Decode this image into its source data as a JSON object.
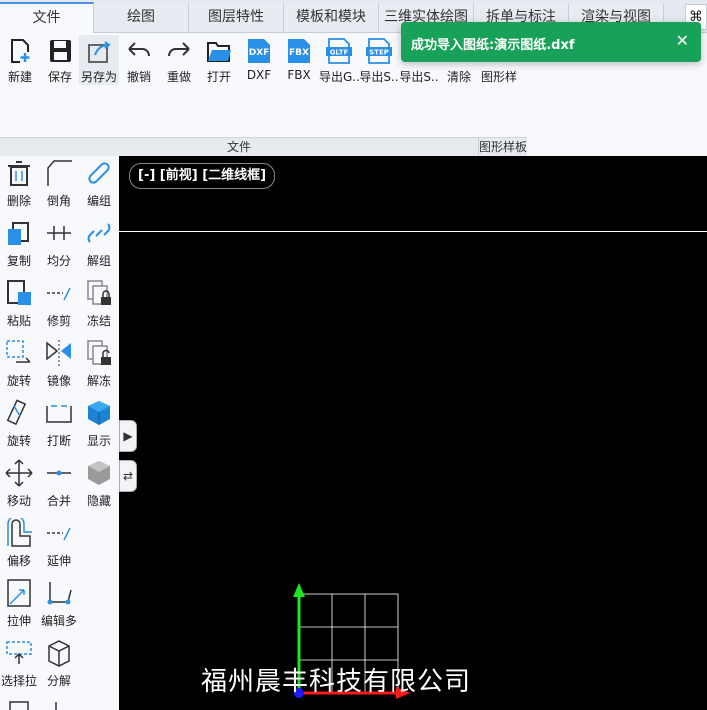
{
  "tabs": [
    {
      "label": "文件",
      "active": true
    },
    {
      "label": "绘图"
    },
    {
      "label": "图层特性"
    },
    {
      "label": "模板和模块"
    },
    {
      "label": "三维实体绘图"
    },
    {
      "label": "拆单与标注"
    },
    {
      "label": "渲染与视图"
    }
  ],
  "tab_more_icon": "command-icon",
  "ribbon": {
    "buttons": [
      {
        "label": "新建",
        "icon": "new-file-icon"
      },
      {
        "label": "保存",
        "icon": "save-icon"
      },
      {
        "label": "另存为",
        "icon": "save-as-icon"
      },
      {
        "label": "撤销",
        "icon": "undo-icon"
      },
      {
        "label": "重做",
        "icon": "redo-icon"
      },
      {
        "label": "打开",
        "icon": "folder-open-icon"
      },
      {
        "label": "DXF",
        "icon": "dxf-icon",
        "badge": "DXF"
      },
      {
        "label": "FBX",
        "icon": "fbx-icon",
        "badge": "FBX"
      },
      {
        "label": "导出G..",
        "icon": "export-gltf-icon",
        "badge": "GLTF"
      },
      {
        "label": "导出S..",
        "icon": "export-step-icon",
        "badge": "STEP"
      },
      {
        "label": "导出S..",
        "icon": "export-s-icon"
      },
      {
        "label": "清除",
        "icon": "clear-icon"
      },
      {
        "label": "图形样",
        "icon": "shape-style-icon"
      }
    ],
    "groups": [
      {
        "label": "文件"
      },
      {
        "label": "图形样板"
      }
    ]
  },
  "toast": {
    "message": "成功导入图纸:演示图纸.dxf",
    "close": "✕",
    "color": "#18a158"
  },
  "left_toolbar": [
    {
      "label": "删除",
      "icon": "delete-icon"
    },
    {
      "label": "倒角",
      "icon": "chamfer-icon"
    },
    {
      "label": "编组",
      "icon": "group-icon"
    },
    {
      "label": "复制",
      "icon": "copy-icon"
    },
    {
      "label": "均分",
      "icon": "divide-icon"
    },
    {
      "label": "解组",
      "icon": "ungroup-icon"
    },
    {
      "label": "粘贴",
      "icon": "paste-icon"
    },
    {
      "label": "修剪",
      "icon": "trim-icon"
    },
    {
      "label": "冻结",
      "icon": "freeze-icon"
    },
    {
      "label": "旋转",
      "icon": "rotate-icon"
    },
    {
      "label": "镜像",
      "icon": "mirror-icon"
    },
    {
      "label": "解冻",
      "icon": "unfreeze-icon"
    },
    {
      "label": "旋转",
      "icon": "rotate-3d-icon"
    },
    {
      "label": "打断",
      "icon": "break-icon"
    },
    {
      "label": "显示",
      "icon": "show-icon"
    },
    {
      "label": "移动",
      "icon": "move-icon"
    },
    {
      "label": "合并",
      "icon": "join-icon"
    },
    {
      "label": "隐藏",
      "icon": "hide-icon"
    },
    {
      "label": "偏移",
      "icon": "offset-icon"
    },
    {
      "label": "延伸",
      "icon": "extend-icon"
    },
    {
      "label": "拉伸",
      "icon": "stretch-icon"
    },
    {
      "label": "编辑多",
      "icon": "edit-polyline-icon"
    },
    {
      "label": "选择拉",
      "icon": "select-stretch-icon"
    },
    {
      "label": "分解",
      "icon": "explode-icon"
    }
  ],
  "viewport": {
    "view_label": "[-]  [前视]  [二维线框]",
    "watermark": "福州晨丰科技有限公司",
    "handles": [
      {
        "icon": "collapse-right-icon",
        "glyph": "▶"
      },
      {
        "icon": "swap-icon",
        "glyph": "⇄"
      }
    ]
  },
  "colors": {
    "accent": "#2a8fe6",
    "toast": "#18a158",
    "axis_x": "#ff1a1a",
    "axis_y": "#1ee61e",
    "origin": "#1a1aff"
  }
}
